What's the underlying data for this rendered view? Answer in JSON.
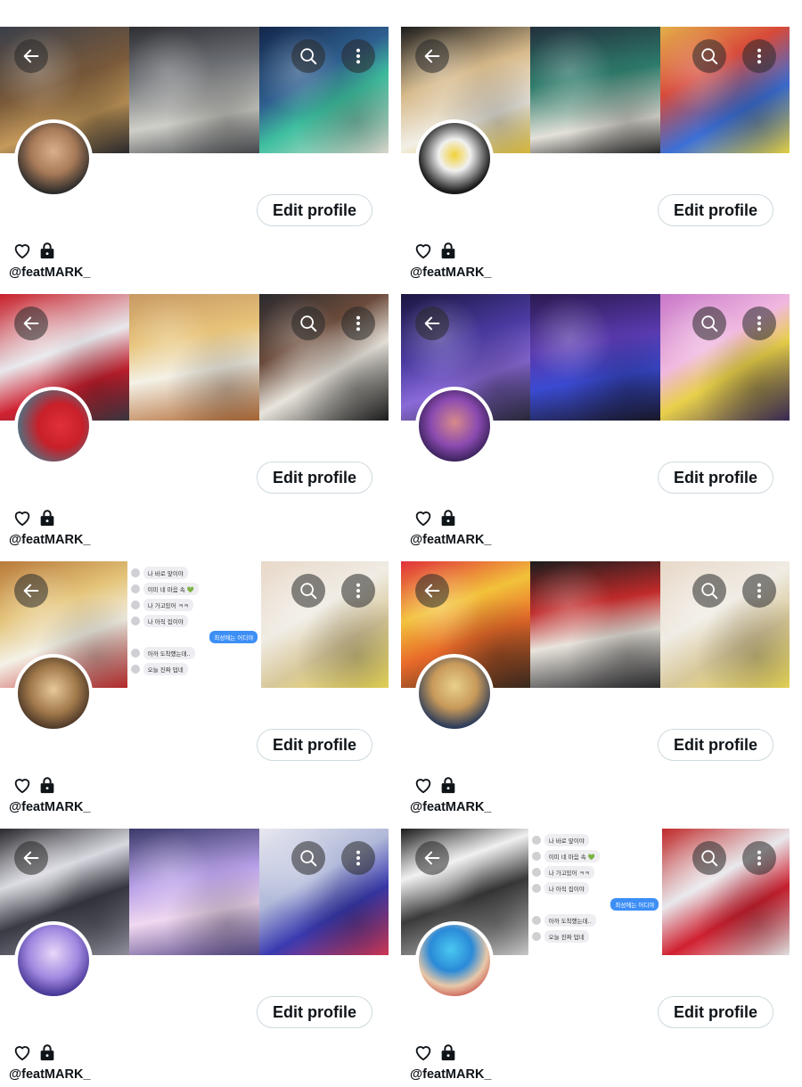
{
  "profiles": [
    {
      "handle": "@featMARK_",
      "edit_label": "Edit profile",
      "banner": [
        "linear-gradient(160deg,#3a3f4a 0%,#7a5a3a 45%,#c59a5b 70%,#2b2b30 100%)",
        "linear-gradient(170deg,#2e2e33 0%,#6c6f74 35%,#cfcfc8 70%,#4a4d52 100%)",
        "linear-gradient(150deg,#13264a 0%,#2f5f8f 40%,#3fbf9f 60%,#e9e6da 100%)"
      ],
      "avatar": "radial-gradient(circle at 50% 40%,#d9b08c 0%,#a87a58 40%,#2a2a2a 75%)"
    },
    {
      "handle": "@featMARK_",
      "edit_label": "Edit profile",
      "banner": [
        "linear-gradient(160deg,#1c1c1c 0%,#d6b98a 40%,#f2efe6 70%,#e4c23a 100%)",
        "linear-gradient(170deg,#23303d 0%,#2d7a6a 40%,#e3e1d8 75%,#2a2a2a 100%)",
        "linear-gradient(150deg,#e4b04a 0%,#d84a3a 35%,#3c6fd6 65%,#f4e04a 100%)"
      ],
      "avatar": "radial-gradient(circle at 50% 45%,#f3d23a 0%,#f0f0f0 30%,#1a1a1a 70%)"
    },
    {
      "handle": "@featMARK_",
      "edit_label": "Edit profile",
      "banner": [
        "linear-gradient(160deg,#c8202a 0%,#e8e8ec 45%,#d02030 70%,#3a3a44 100%)",
        "linear-gradient(170deg,#c89a64 0%,#e8c47a 35%,#f4f1e6 60%,#b36a34 100%)",
        "linear-gradient(150deg,#2a2a2e 0%,#6a4a3a 35%,#e8e4dc 60%,#1c1c1c 100%)"
      ],
      "avatar": "radial-gradient(circle at 60% 50%,#e0303a 0%,#c8202a 40%,#5a6a7a 75%)"
    },
    {
      "handle": "@featMARK_",
      "edit_label": "Edit profile",
      "banner": [
        "linear-gradient(160deg,#1a1640 0%,#4a3aa0 40%,#8a6ad8 65%,#2a2a3a 100%)",
        "linear-gradient(170deg,#2a1a50 0%,#5a3ab0 40%,#3a4ad0 65%,#1a1a2a 100%)",
        "linear-gradient(150deg,#c878c8 0%,#f0b8e0 40%,#e8d04a 60%,#3a2a5a 100%)"
      ],
      "avatar": "radial-gradient(circle at 50% 45%,#d88a8a 0%,#8a4ab0 45%,#2a1a4a 80%)"
    },
    {
      "handle": "@featMARK_",
      "edit_label": "Edit profile",
      "banner": [
        "linear-gradient(160deg,#b87a3a 0%,#e4c47a 35%,#f4f1e6 60%,#c02a2a 100%)",
        "chat",
        "linear-gradient(150deg,#e8d8c8 0%,#f0ece4 40%,#d8c89a 65%,#f2e05a 100%)"
      ],
      "avatar": "radial-gradient(circle at 50% 45%,#e8c89a 0%,#a0784a 45%,#3a2a20 80%)"
    },
    {
      "handle": "@featMARK_",
      "edit_label": "Edit profile",
      "banner": [
        "linear-gradient(160deg,#e0303a 0%,#f2c23a 35%,#e86a2a 60%,#3a2a20 100%)",
        "linear-gradient(170deg,#1c1c1c 0%,#c02a2a 35%,#e8e4dc 60%,#2a2a2e 100%)",
        "linear-gradient(150deg,#e8d8c8 0%,#f0ece4 40%,#d8c89a 65%,#f2e05a 100%)"
      ],
      "avatar": "radial-gradient(circle at 50% 40%,#e8d08a 0%,#c89a5a 40%,#2a3a5a 75%)"
    },
    {
      "handle": "@featMARK_",
      "edit_label": "Edit profile",
      "banner": [
        "linear-gradient(160deg,#2a2a2e 0%,#d8d8e0 35%,#3a3a44 60%,#9a9aa8 100%)",
        "linear-gradient(170deg,#3a3a6a 0%,#b8a0e8 40%,#f0d8f0 65%,#5a4a8a 100%)",
        "linear-gradient(150deg,#e8e8f0 0%,#b0b8d8 40%,#3a3ab0 65%,#e03a5a 100%)"
      ],
      "avatar": "radial-gradient(circle at 50% 40%,#e8d8f8 0%,#a088e0 45%,#3a2a8a 80%)"
    },
    {
      "handle": "@featMARK_",
      "edit_label": "Edit profile",
      "banner": [
        "linear-gradient(160deg,#1c1c1c 0%,#f0f0f0 30%,#3a3a3a 55%,#d8d8d8 100%)",
        "chat",
        "linear-gradient(150deg,#c02a2a 0%,#e8e8ec 40%,#d02030 65%,#f0f0f0 100%)"
      ],
      "avatar": "radial-gradient(circle at 45% 35%,#4ac8f0 0%,#2a8ad8 35%,#e8c8a8 60%,#c02a2a 90%)"
    }
  ],
  "chat": {
    "messages": [
      {
        "text": "나 바로 앞이야",
        "mine": false
      },
      {
        "text": "이미 네 마음 속 💚",
        "mine": false
      },
      {
        "text": "나 가고있어 ㅋㅋ",
        "mine": false
      },
      {
        "text": "나 아직 집이야",
        "mine": false
      },
      {
        "text": "최성에는 어디야",
        "mine": true
      },
      {
        "text": "아까 도착했는데..",
        "mine": false
      },
      {
        "text": "오늘 진짜 덥네",
        "mine": false
      }
    ]
  },
  "colors": {
    "button_border": "#cfd9de",
    "text": "#0f1419",
    "overlay": "rgba(40,40,40,0.55)"
  },
  "icons": [
    "back-arrow-icon",
    "search-icon",
    "more-vertical-icon",
    "heart-icon",
    "lock-icon"
  ]
}
